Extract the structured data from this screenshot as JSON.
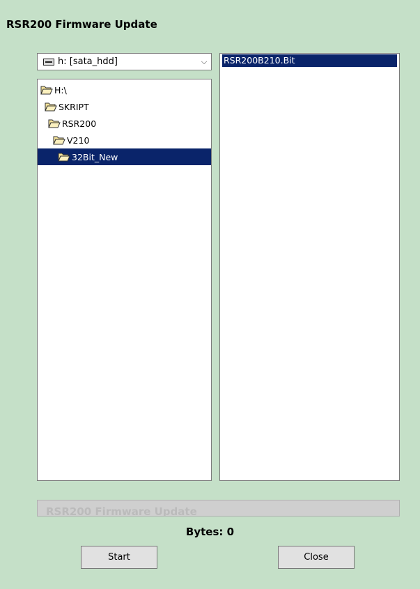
{
  "window": {
    "title": "RSR200 Firmware Update"
  },
  "drive": {
    "selected": "h: [sata_hdd]"
  },
  "tree": {
    "items": [
      {
        "label": "H:\\"
      },
      {
        "label": "SKRIPT"
      },
      {
        "label": "RSR200"
      },
      {
        "label": "V210"
      },
      {
        "label": "32Bit_New",
        "selected": true
      }
    ]
  },
  "files": {
    "items": [
      {
        "label": "RSR200B210.Bit",
        "selected": true
      }
    ]
  },
  "progress": {
    "label": "RSR200 Firmware Update",
    "fraction": 0
  },
  "status": {
    "bytes_label": "Bytes:",
    "bytes_value": "0"
  },
  "buttons": {
    "start_label": "Start",
    "close_label": "Close"
  },
  "colors": {
    "background": "#c5e0c8",
    "selection": "#0a246a"
  }
}
